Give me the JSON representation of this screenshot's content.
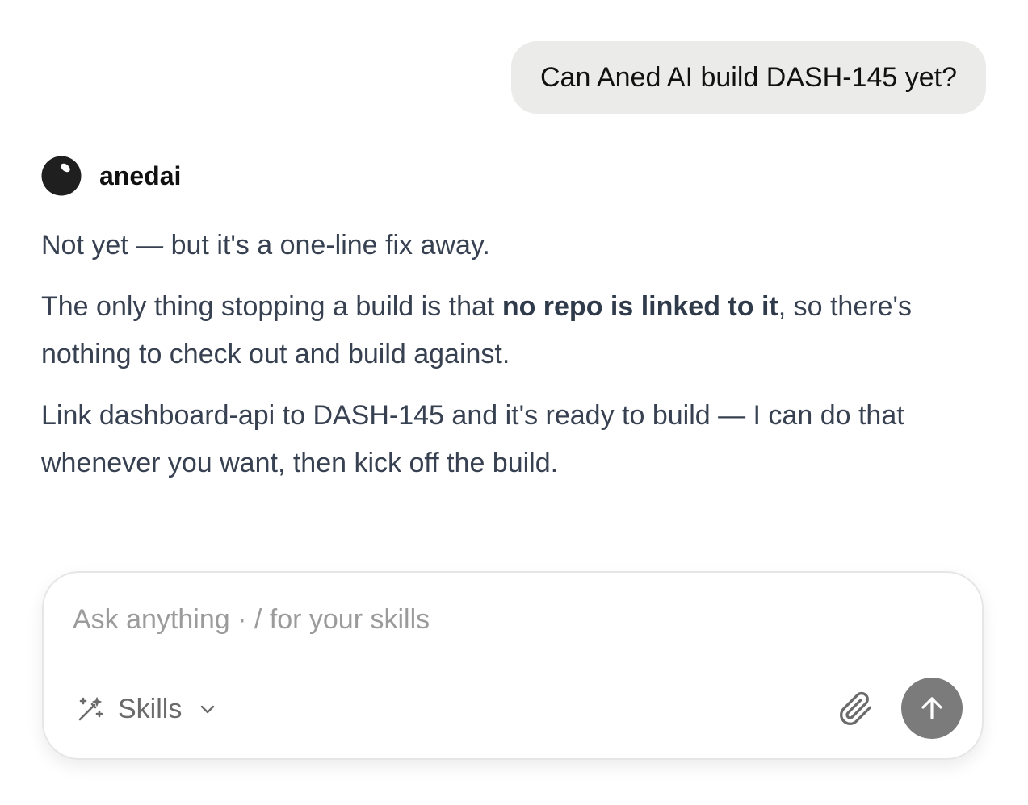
{
  "user_message": {
    "text": "Can Aned AI build DASH-145 yet?"
  },
  "assistant": {
    "name": "anedai",
    "avatar_icon": "anedai-avatar-icon",
    "paragraphs": {
      "p1": "Not yet — but it's a one-line fix away.",
      "p2_prefix": "The only thing stopping a build is that ",
      "p2_bold": "no repo is linked to it",
      "p2_suffix": ", so there's nothing to check out and build against.",
      "p3": "Link dashboard-api to DASH-145 and it's ready to build — I can do that whenever you want, then kick off the build."
    }
  },
  "composer": {
    "placeholder": "Ask anything · / for your skills",
    "value": "",
    "skills_label": "Skills",
    "skills_icon": "magic-wand-icon",
    "chevron_icon": "chevron-down-icon",
    "attach_icon": "paperclip-icon",
    "send_icon": "arrow-up-icon"
  },
  "colors": {
    "user_bubble_bg": "#ebebea",
    "body_text": "#374151",
    "placeholder": "#9b9b9b",
    "send_button_bg": "#7b7b7b"
  }
}
